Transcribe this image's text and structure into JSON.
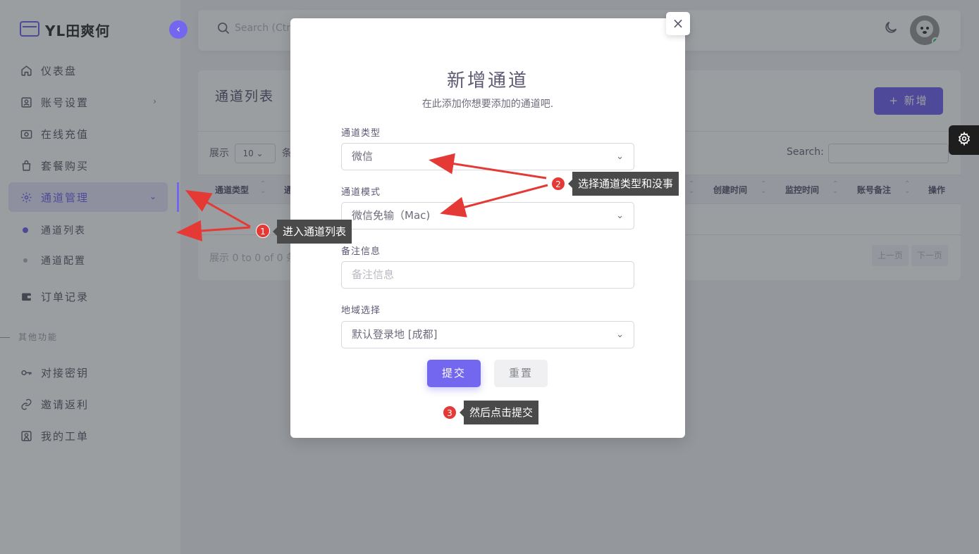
{
  "sidebar": {
    "logo_text": "YL田爽何",
    "collapse_icon": "‹",
    "items": [
      {
        "label": "仪表盘",
        "icon": "home-icon"
      },
      {
        "label": "账号设置",
        "icon": "user-card-icon",
        "chevron": "›"
      },
      {
        "label": "在线充值",
        "icon": "camera-icon"
      },
      {
        "label": "套餐购买",
        "icon": "bag-icon"
      },
      {
        "label": "通道管理",
        "icon": "gear-icon",
        "chevron": "⌄"
      },
      {
        "label": "订单记录",
        "icon": "wallet-icon"
      }
    ],
    "sub_items": [
      {
        "label": "通道列表"
      },
      {
        "label": "通道配置"
      }
    ],
    "section_label": "其他功能",
    "other_items": [
      {
        "label": "对接密钥",
        "icon": "key-icon"
      },
      {
        "label": "邀请返利",
        "icon": "link-icon"
      },
      {
        "label": "我的工单",
        "icon": "ticket-icon"
      }
    ]
  },
  "topbar": {
    "search_placeholder": "Search (Ctrl+/)"
  },
  "card": {
    "title": "通道列表",
    "add_button": "+ 新增",
    "show_label": "展示",
    "page_size": "10 ⌄",
    "show_suffix": "条",
    "search_label": "Search:",
    "columns": [
      "通道类型",
      "通",
      "创建时间",
      "监控时间",
      "账号备注",
      "操作"
    ],
    "footer_text": "展示 0 to 0 of 0 条",
    "prev": "上一页",
    "next": "下一页"
  },
  "modal": {
    "close": "×",
    "title": "新增通道",
    "subtitle": "在此添加你想要添加的通道吧.",
    "fields": {
      "type_label": "通道类型",
      "type_value": "微信",
      "mode_label": "通道模式",
      "mode_value": "微信免输（Mac)",
      "note_label": "备注信息",
      "note_placeholder": "备注信息",
      "region_label": "地域选择",
      "region_value": "默认登录地 [成都]"
    },
    "submit": "提交",
    "reset": "重置",
    "dropdown_icon": "⌄"
  },
  "annotations": [
    {
      "number": "1",
      "text": "进入通道列表"
    },
    {
      "number": "2",
      "text": "选择通道类型和没事"
    },
    {
      "number": "3",
      "text": "然后点击提交"
    }
  ],
  "colors": {
    "accent": "#7367f0",
    "annotation_red": "#e53935",
    "annotation_bg": "#4a4a4a"
  }
}
